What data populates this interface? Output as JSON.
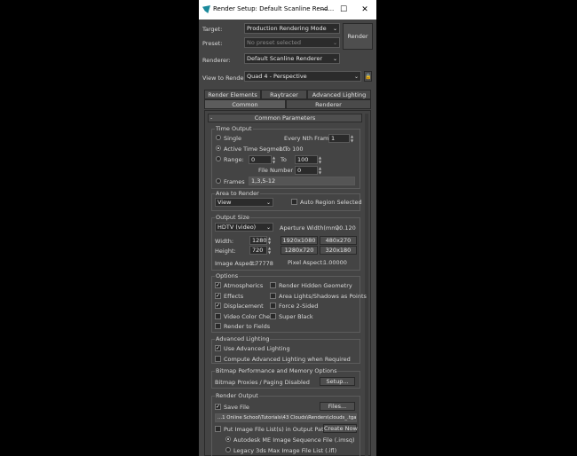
{
  "window": {
    "title": "Render Setup: Default Scanline Rend...",
    "minimize": "—",
    "maximize": "☐",
    "close": "✕"
  },
  "top": {
    "target_label": "Target:",
    "target_value": "Production Rendering Mode",
    "preset_label": "Preset:",
    "preset_value": "No preset selected",
    "renderer_label": "Renderer:",
    "renderer_value": "Default Scanline Renderer",
    "render_button": "Render",
    "view_label": "View to Render:",
    "view_value": "Quad 4 - Perspective"
  },
  "tabs": {
    "row1": [
      "Render Elements",
      "Raytracer",
      "Advanced Lighting"
    ],
    "row2": [
      "Common",
      "Renderer"
    ],
    "active": "Common"
  },
  "rollout": {
    "toggle": "-",
    "title": "Common Parameters"
  },
  "time_output": {
    "title": "Time Output",
    "single": "Single",
    "every_nth_label": "Every Nth Frame:",
    "every_nth_value": "1",
    "active_segment": "Active Time Segment:",
    "active_range": "1 To 100",
    "range": "Range:",
    "range_from": "0",
    "range_to_label": "To",
    "range_to": "100",
    "file_number_base_label": "File Number Base:",
    "file_number_base": "0",
    "frames": "Frames",
    "frames_value": "1,3,5-12"
  },
  "area": {
    "title": "Area to Render",
    "value": "View",
    "auto_region": "Auto Region Selected"
  },
  "output_size": {
    "title": "Output Size",
    "preset": "HDTV (video)",
    "aperture_label": "Aperture Width(mm):",
    "aperture_value": "20.120",
    "width_label": "Width:",
    "width_value": "1280",
    "height_label": "Height:",
    "height_value": "720",
    "presets": [
      "1920x1080",
      "480x270",
      "1280x720",
      "320x180"
    ],
    "image_aspect_label": "Image Aspect:",
    "image_aspect_value": "1.77778",
    "pixel_aspect_label": "Pixel Aspect:",
    "pixel_aspect_value": "1.00000"
  },
  "options": {
    "title": "Options",
    "left": [
      {
        "label": "Atmospherics",
        "checked": true
      },
      {
        "label": "Effects",
        "checked": true
      },
      {
        "label": "Displacement",
        "checked": true
      },
      {
        "label": "Video Color Check",
        "checked": false
      },
      {
        "label": "Render to Fields",
        "checked": false
      }
    ],
    "right": [
      {
        "label": "Render Hidden Geometry",
        "checked": false
      },
      {
        "label": "Area Lights/Shadows as Points",
        "checked": false
      },
      {
        "label": "Force 2-Sided",
        "checked": false
      },
      {
        "label": "Super Black",
        "checked": false
      }
    ]
  },
  "advanced_lighting": {
    "title": "Advanced Lighting",
    "use": "Use Advanced Lighting",
    "compute": "Compute Advanced Lighting when Required"
  },
  "bitmap": {
    "title": "Bitmap Performance and Memory Options",
    "status": "Bitmap Proxies / Paging Disabled",
    "setup_button": "Setup..."
  },
  "render_output": {
    "title": "Render Output",
    "save_file": "Save File",
    "files_button": "Files...",
    "path": "...1 Online School\\Tutorials\\43 Clouds\\Renders\\clouds_.tga",
    "put_image": "Put Image File List(s) in Output Path(s)",
    "create_now": "Create Now",
    "autodesk": "Autodesk ME Image Sequence File (.imsq)",
    "legacy": "Legacy 3ds Max Image File List (.ifl)"
  }
}
